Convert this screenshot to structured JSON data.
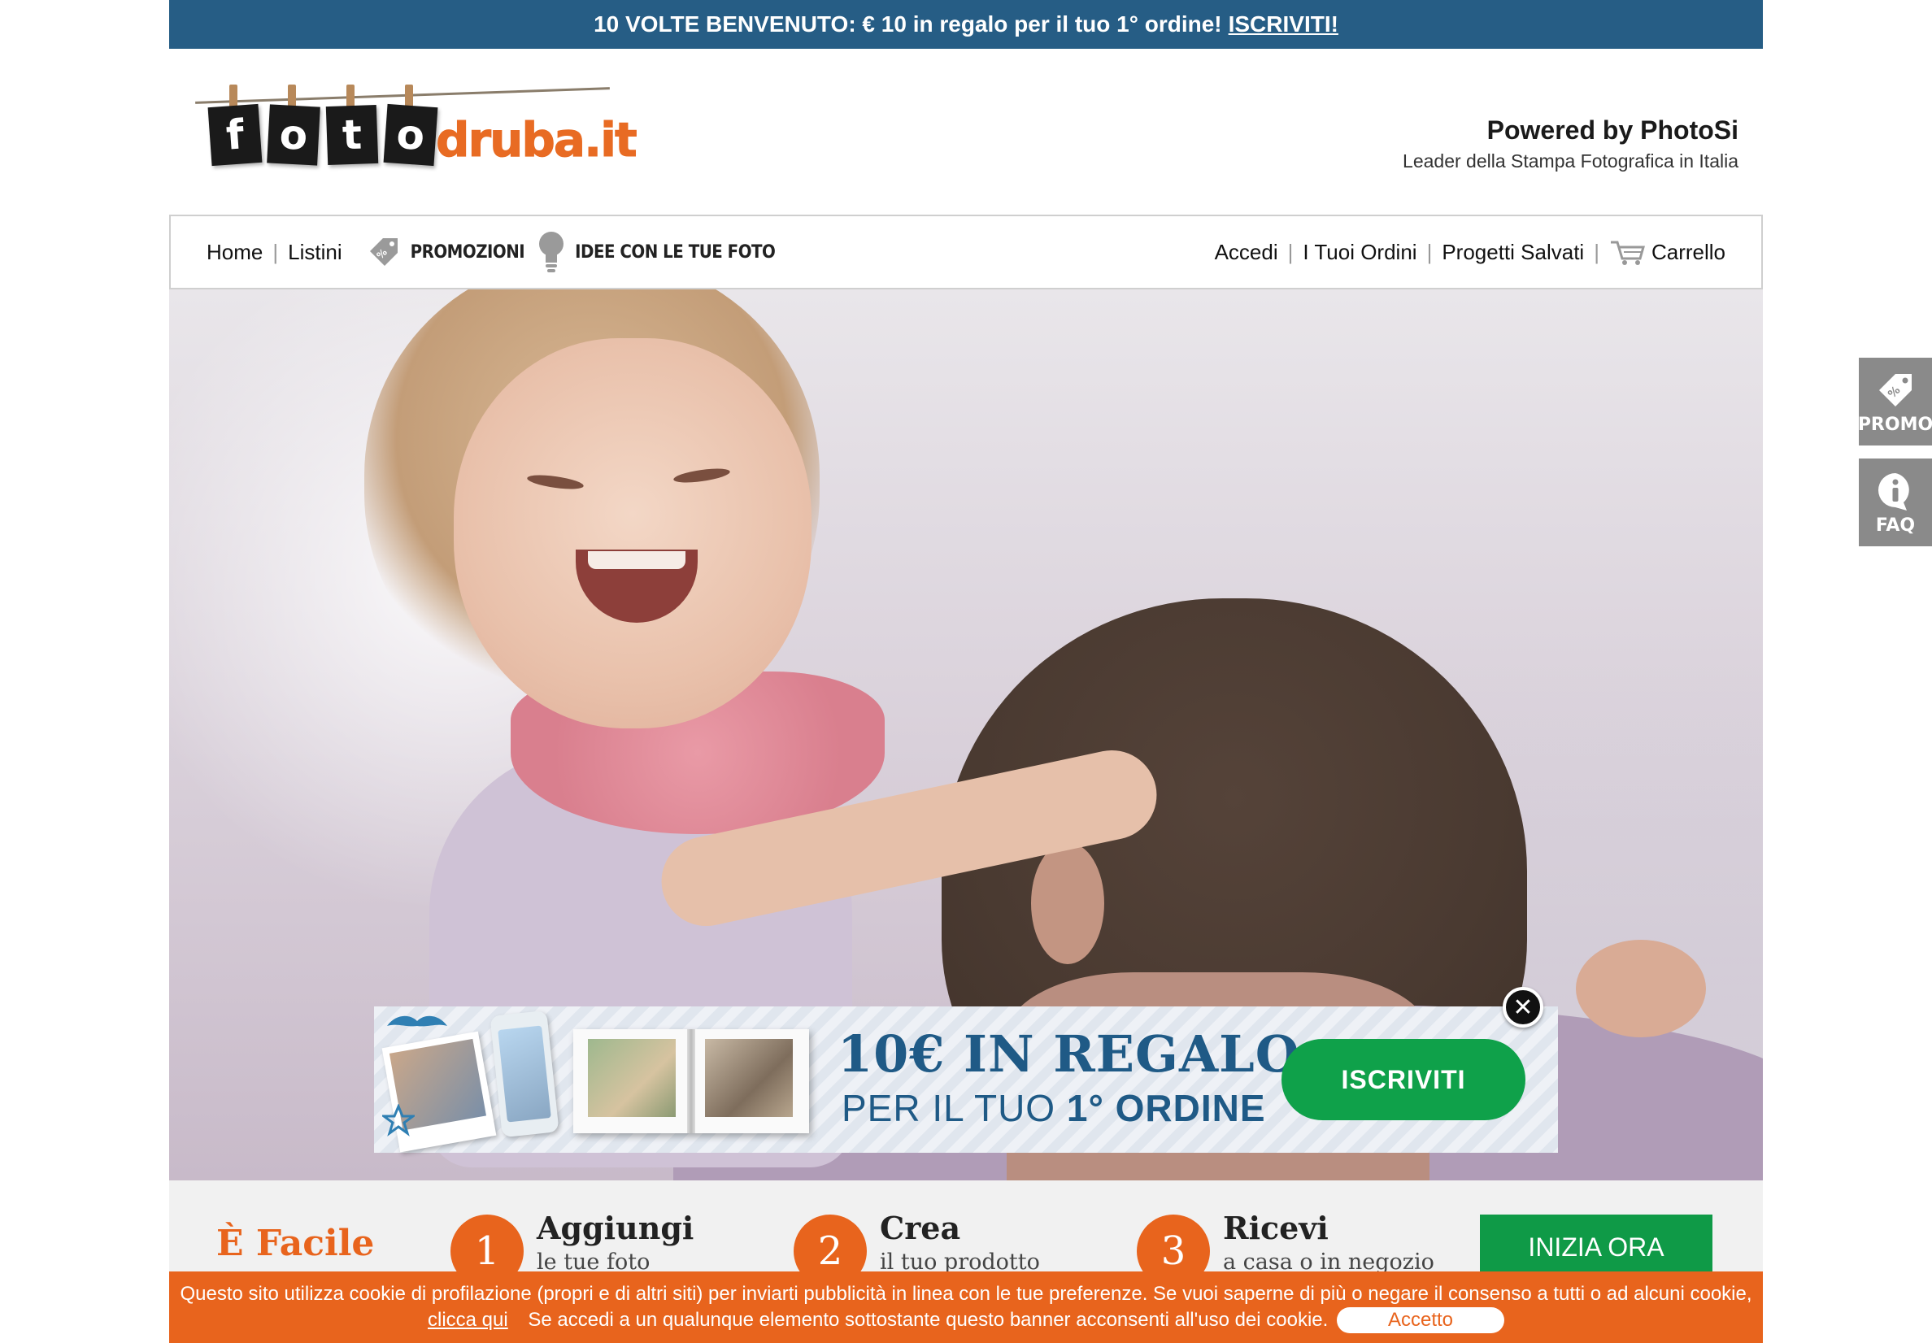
{
  "topbar": {
    "text": "10 VOLTE BENVENUTO: € 10 in regalo per il tuo 1° ordine!",
    "link": "ISCRIVITI!"
  },
  "logo": {
    "tiles": [
      "f",
      "o",
      "t",
      "o"
    ],
    "suffix": "druba.it"
  },
  "powered": {
    "line1": "Powered by PhotoSi",
    "line2": "Leader della Stampa Fotografica in Italia"
  },
  "nav": {
    "home": "Home",
    "listini": "Listini",
    "promozioni": "PROMOZIONI",
    "idee": "IDEE CON LE TUE FOTO",
    "accedi": "Accedi",
    "ordini": "I Tuoi Ordini",
    "progetti": "Progetti Salvati",
    "carrello": "Carrello"
  },
  "banner": {
    "headline": "10€ IN REGALO",
    "sub_prefix": "PER IL TUO",
    "sub_bold": "1° ORDINE",
    "cta": "ISCRIVITI",
    "close": "✕"
  },
  "side": {
    "promo": "PROMO",
    "faq": "FAQ"
  },
  "steps": {
    "easy": "È Facile",
    "items": [
      {
        "num": "1",
        "title": "Aggiungi",
        "sub": "le tue foto"
      },
      {
        "num": "2",
        "title": "Crea",
        "sub": "il tuo prodotto"
      },
      {
        "num": "3",
        "title": "Ricevi",
        "sub": "a casa o in negozio"
      }
    ],
    "start": "INIZIA ORA"
  },
  "cookie": {
    "line1": "Questo sito utilizza cookie di profilazione (propri e di altri siti) per inviarti pubblicità in linea con le tue preferenze. Se vuoi saperne di più o negare il consenso a tutti o ad alcuni cookie,",
    "link": "clicca qui",
    "line2": "Se accedi a un qualunque elemento sottostante questo banner acconsenti all'uso dei cookie.",
    "accept": "Accetto"
  },
  "colors": {
    "topbar": "#265d85",
    "orange": "#e8641d",
    "green": "#0fa14a",
    "banner_blue": "#1f5a86"
  }
}
